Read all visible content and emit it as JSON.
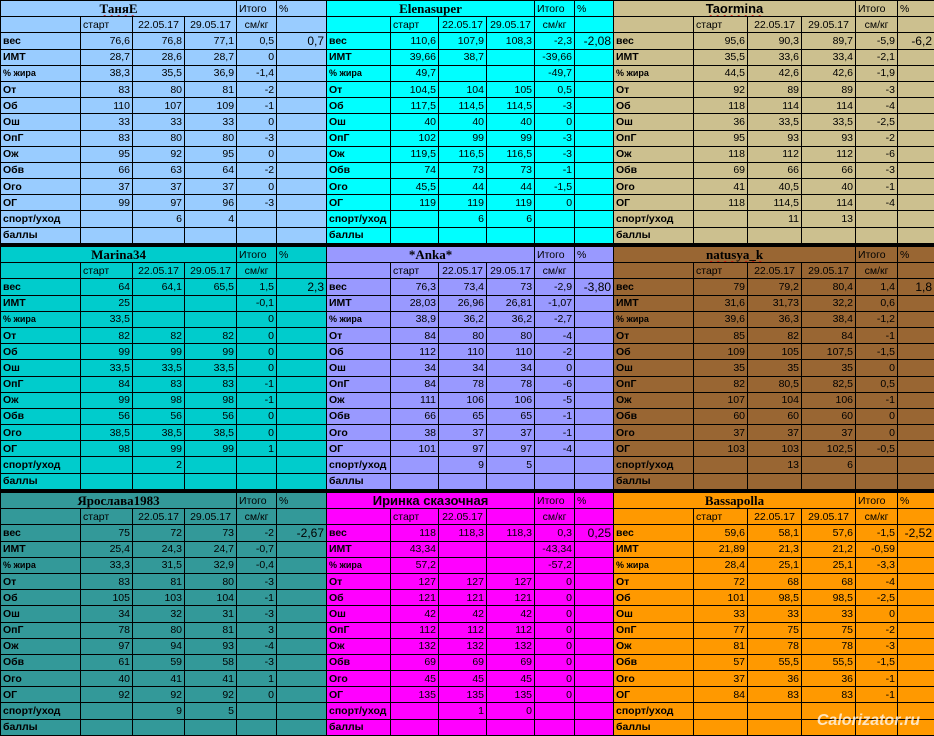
{
  "watermark": "Calorizator.ru",
  "blocks": [
    {
      "name": "ТаняЕ",
      "color": "c-blue",
      "total_label": "Итого",
      "pct_label": "%",
      "sub": [
        "старт",
        "22.05.17",
        "29.05.17",
        "см/кг"
      ],
      "rows": [
        [
          "вес",
          "76,6",
          "76,8",
          "77,1",
          "0,5",
          "0,7"
        ],
        [
          "ИМТ",
          "28,7",
          "28,6",
          "28,7",
          "0",
          ""
        ],
        [
          "% жира",
          "38,3",
          "35,5",
          "36,9",
          "-1,4",
          ""
        ],
        [
          "От",
          "83",
          "80",
          "81",
          "-2",
          ""
        ],
        [
          "Об",
          "110",
          "107",
          "109",
          "-1",
          ""
        ],
        [
          "Ош",
          "33",
          "33",
          "33",
          "0",
          ""
        ],
        [
          "ОпГ",
          "83",
          "80",
          "80",
          "-3",
          ""
        ],
        [
          "Ож",
          "95",
          "92",
          "95",
          "0",
          ""
        ],
        [
          "Обв",
          "66",
          "63",
          "64",
          "-2",
          ""
        ],
        [
          "Ого",
          "37",
          "37",
          "37",
          "0",
          ""
        ],
        [
          "ОГ",
          "99",
          "97",
          "96",
          "-3",
          ""
        ],
        [
          "спорт/уход",
          "",
          "6",
          "4",
          "",
          ""
        ],
        [
          "баллы",
          "",
          "",
          "",
          "",
          ""
        ]
      ]
    },
    {
      "name": "Elenasuper",
      "color": "c-cyan",
      "total_label": "Итого",
      "pct_label": "%",
      "sub": [
        "старт",
        "22.05.17",
        "29.05.17",
        "см/кг"
      ],
      "rows": [
        [
          "вес",
          "110,6",
          "107,9",
          "108,3",
          "-2,3",
          "-2,08"
        ],
        [
          "ИМТ",
          "39,66",
          "38,7",
          "",
          "-39,66",
          ""
        ],
        [
          "% жира",
          "49,7",
          "",
          "",
          "-49,7",
          ""
        ],
        [
          "От",
          "104,5",
          "104",
          "105",
          "0,5",
          ""
        ],
        [
          "Об",
          "117,5",
          "114,5",
          "114,5",
          "-3",
          ""
        ],
        [
          "Ош",
          "40",
          "40",
          "40",
          "0",
          ""
        ],
        [
          "ОпГ",
          "102",
          "99",
          "99",
          "-3",
          ""
        ],
        [
          "Ож",
          "119,5",
          "116,5",
          "116,5",
          "-3",
          ""
        ],
        [
          "Обв",
          "74",
          "73",
          "73",
          "-1",
          ""
        ],
        [
          "Ого",
          "45,5",
          "44",
          "44",
          "-1,5",
          ""
        ],
        [
          "ОГ",
          "119",
          "119",
          "119",
          "0",
          ""
        ],
        [
          "спорт/уход",
          "",
          "6",
          "6",
          "",
          ""
        ],
        [
          "баллы",
          "",
          "",
          "",
          "",
          ""
        ]
      ]
    },
    {
      "name": "Taormina",
      "color": "c-tan",
      "total_label": "Итого",
      "pct_label": "%",
      "sub": [
        "старт",
        "22.05.17",
        "29.05.17",
        "см/кг"
      ],
      "rows": [
        [
          "вес",
          "95,6",
          "90,3",
          "89,7",
          "-5,9",
          "-6,2"
        ],
        [
          "ИМТ",
          "35,5",
          "33,6",
          "33,4",
          "-2,1",
          ""
        ],
        [
          "% жира",
          "44,5",
          "42,6",
          "42,6",
          "-1,9",
          ""
        ],
        [
          "От",
          "92",
          "89",
          "89",
          "-3",
          ""
        ],
        [
          "Об",
          "118",
          "114",
          "114",
          "-4",
          ""
        ],
        [
          "Ош",
          "36",
          "33,5",
          "33,5",
          "-2,5",
          ""
        ],
        [
          "ОпГ",
          "95",
          "93",
          "93",
          "-2",
          ""
        ],
        [
          "Ож",
          "118",
          "112",
          "112",
          "-6",
          ""
        ],
        [
          "Обв",
          "69",
          "66",
          "66",
          "-3",
          ""
        ],
        [
          "Ого",
          "41",
          "40,5",
          "40",
          "-1",
          ""
        ],
        [
          "ОГ",
          "118",
          "114,5",
          "114",
          "-4",
          ""
        ],
        [
          "спорт/уход",
          "",
          "11",
          "13",
          "",
          ""
        ],
        [
          "баллы",
          "",
          "",
          "",
          "",
          ""
        ]
      ]
    },
    {
      "name": "Marina34",
      "color": "c-teal",
      "total_label": "Итого",
      "pct_label": "%",
      "sub": [
        "старт",
        "22.05.17",
        "29.05.17",
        "см/кг"
      ],
      "rows": [
        [
          "вес",
          "64",
          "64,1",
          "65,5",
          "1,5",
          "2,3"
        ],
        [
          "ИМТ",
          "25",
          "",
          "",
          "-0,1",
          ""
        ],
        [
          "% жира",
          "33,5",
          "",
          "",
          "0",
          ""
        ],
        [
          "От",
          "82",
          "82",
          "82",
          "0",
          ""
        ],
        [
          "Об",
          "99",
          "99",
          "99",
          "0",
          ""
        ],
        [
          "Ош",
          "33,5",
          "33,5",
          "33,5",
          "0",
          ""
        ],
        [
          "ОпГ",
          "84",
          "83",
          "83",
          "-1",
          ""
        ],
        [
          "Ож",
          "99",
          "98",
          "98",
          "-1",
          ""
        ],
        [
          "Обв",
          "56",
          "56",
          "56",
          "0",
          ""
        ],
        [
          "Ого",
          "38,5",
          "38,5",
          "38,5",
          "0",
          ""
        ],
        [
          "ОГ",
          "98",
          "99",
          "99",
          "1",
          ""
        ],
        [
          "спорт/уход",
          "",
          "2",
          "",
          "",
          ""
        ],
        [
          "баллы",
          "",
          "",
          "",
          "",
          ""
        ]
      ]
    },
    {
      "name": "*Anka*",
      "color": "c-lav",
      "total_label": "Итого",
      "pct_label": "%",
      "sub": [
        "старт",
        "22.05.17",
        "29.05.17",
        "см/кг"
      ],
      "rows": [
        [
          "вес",
          "76,3",
          "73,4",
          "73",
          "-2,9",
          "-3,80"
        ],
        [
          "ИМТ",
          "28,03",
          "26,96",
          "26,81",
          "-1,07",
          ""
        ],
        [
          "% жира",
          "38,9",
          "36,2",
          "36,2",
          "-2,7",
          ""
        ],
        [
          "От",
          "84",
          "80",
          "80",
          "-4",
          ""
        ],
        [
          "Об",
          "112",
          "110",
          "110",
          "-2",
          ""
        ],
        [
          "Ош",
          "34",
          "34",
          "34",
          "0",
          ""
        ],
        [
          "ОпГ",
          "84",
          "78",
          "78",
          "-6",
          ""
        ],
        [
          "Ож",
          "111",
          "106",
          "106",
          "-5",
          ""
        ],
        [
          "Обв",
          "66",
          "65",
          "65",
          "-1",
          ""
        ],
        [
          "Ого",
          "38",
          "37",
          "37",
          "-1",
          ""
        ],
        [
          "ОГ",
          "101",
          "97",
          "97",
          "-4",
          ""
        ],
        [
          "спорт/уход",
          "",
          "9",
          "5",
          "",
          ""
        ],
        [
          "баллы",
          "",
          "",
          "",
          "",
          ""
        ]
      ]
    },
    {
      "name": "natusya_k",
      "color": "c-brown",
      "total_label": "Итого",
      "pct_label": "%",
      "sub": [
        "старт",
        "22.05.17",
        "29.05.17",
        "см/кг"
      ],
      "rows": [
        [
          "вес",
          "79",
          "79,2",
          "80,4",
          "1,4",
          "1,8"
        ],
        [
          "ИМТ",
          "31,6",
          "31,73",
          "32,2",
          "0,6",
          ""
        ],
        [
          "% жира",
          "39,6",
          "36,3",
          "38,4",
          "-1,2",
          ""
        ],
        [
          "От",
          "85",
          "82",
          "84",
          "-1",
          ""
        ],
        [
          "Об",
          "109",
          "105",
          "107,5",
          "-1,5",
          ""
        ],
        [
          "Ош",
          "35",
          "35",
          "35",
          "0",
          ""
        ],
        [
          "ОпГ",
          "82",
          "80,5",
          "82,5",
          "0,5",
          ""
        ],
        [
          "Ож",
          "107",
          "104",
          "106",
          "-1",
          ""
        ],
        [
          "Обв",
          "60",
          "60",
          "60",
          "0",
          ""
        ],
        [
          "Ого",
          "37",
          "37",
          "37",
          "0",
          ""
        ],
        [
          "ОГ",
          "103",
          "103",
          "102,5",
          "-0,5",
          ""
        ],
        [
          "спорт/уход",
          "",
          "13",
          "6",
          "",
          ""
        ],
        [
          "баллы",
          "",
          "",
          "",
          "",
          ""
        ]
      ]
    },
    {
      "name": "Ярослава1983",
      "color": "c-dteal",
      "total_label": "Итого",
      "pct_label": "%",
      "sub": [
        "старт",
        "22.05.17",
        "29.05.17",
        "см/кг"
      ],
      "rows": [
        [
          "вес",
          "75",
          "72",
          "73",
          "-2",
          "-2,67"
        ],
        [
          "ИМТ",
          "25,4",
          "24,3",
          "24,7",
          "-0,7",
          ""
        ],
        [
          "% жира",
          "33,3",
          "31,5",
          "32,9",
          "-0,4",
          ""
        ],
        [
          "От",
          "83",
          "81",
          "80",
          "-3",
          ""
        ],
        [
          "Об",
          "105",
          "103",
          "104",
          "-1",
          ""
        ],
        [
          "Ош",
          "34",
          "32",
          "31",
          "-3",
          ""
        ],
        [
          "ОпГ",
          "78",
          "80",
          "81",
          "3",
          ""
        ],
        [
          "Ож",
          "97",
          "94",
          "93",
          "-4",
          ""
        ],
        [
          "Обв",
          "61",
          "59",
          "58",
          "-3",
          ""
        ],
        [
          "Ого",
          "40",
          "41",
          "41",
          "1",
          ""
        ],
        [
          "ОГ",
          "92",
          "92",
          "92",
          "0",
          ""
        ],
        [
          "спорт/уход",
          "",
          "9",
          "5",
          "",
          ""
        ],
        [
          "баллы",
          "",
          "",
          "",
          "",
          ""
        ]
      ]
    },
    {
      "name": "Иринка сказочная",
      "color": "c-mag",
      "total_label": "Итого",
      "pct_label": "%",
      "sub": [
        "старт",
        "22.05.17",
        "",
        "см/кг"
      ],
      "rows": [
        [
          "вес",
          "118",
          "118,3",
          "118,3",
          "0,3",
          "0,25"
        ],
        [
          "ИМТ",
          "43,34",
          "",
          "",
          "-43,34",
          ""
        ],
        [
          "% жира",
          "57,2",
          "",
          "",
          "-57,2",
          ""
        ],
        [
          "От",
          "127",
          "127",
          "127",
          "0",
          ""
        ],
        [
          "Об",
          "121",
          "121",
          "121",
          "0",
          ""
        ],
        [
          "Ош",
          "42",
          "42",
          "42",
          "0",
          ""
        ],
        [
          "ОпГ",
          "112",
          "112",
          "112",
          "0",
          ""
        ],
        [
          "Ож",
          "132",
          "132",
          "132",
          "0",
          ""
        ],
        [
          "Обв",
          "69",
          "69",
          "69",
          "0",
          ""
        ],
        [
          "Ого",
          "45",
          "45",
          "45",
          "0",
          ""
        ],
        [
          "ОГ",
          "135",
          "135",
          "135",
          "0",
          ""
        ],
        [
          "спорт/уход",
          "",
          "1",
          "0",
          "",
          ""
        ],
        [
          "баллы",
          "",
          "",
          "",
          "",
          ""
        ]
      ]
    },
    {
      "name": "Bassapolla",
      "color": "c-orange",
      "total_label": "Итого",
      "pct_label": "%",
      "sub": [
        "старт",
        "22.05.17",
        "29.05.17",
        "см/кг"
      ],
      "rows": [
        [
          "вес",
          "59,6",
          "58,1",
          "57,6",
          "-1,5",
          "-2,52"
        ],
        [
          "ИМТ",
          "21,89",
          "21,3",
          "21,2",
          "-0,59",
          ""
        ],
        [
          "% жира",
          "28,4",
          "25,1",
          "25,1",
          "-3,3",
          ""
        ],
        [
          "От",
          "72",
          "68",
          "68",
          "-4",
          ""
        ],
        [
          "Об",
          "101",
          "98,5",
          "98,5",
          "-2,5",
          ""
        ],
        [
          "Ош",
          "33",
          "33",
          "33",
          "0",
          ""
        ],
        [
          "ОпГ",
          "77",
          "75",
          "75",
          "-2",
          ""
        ],
        [
          "Ож",
          "81",
          "78",
          "78",
          "-3",
          ""
        ],
        [
          "Обв",
          "57",
          "55,5",
          "55,5",
          "-1,5",
          ""
        ],
        [
          "Ого",
          "37",
          "36",
          "36",
          "-1",
          ""
        ],
        [
          "ОГ",
          "84",
          "83",
          "83",
          "-1",
          ""
        ],
        [
          "спорт/уход",
          "",
          "",
          "",
          "",
          ""
        ],
        [
          "баллы",
          "",
          "",
          "",
          "",
          ""
        ]
      ]
    }
  ]
}
